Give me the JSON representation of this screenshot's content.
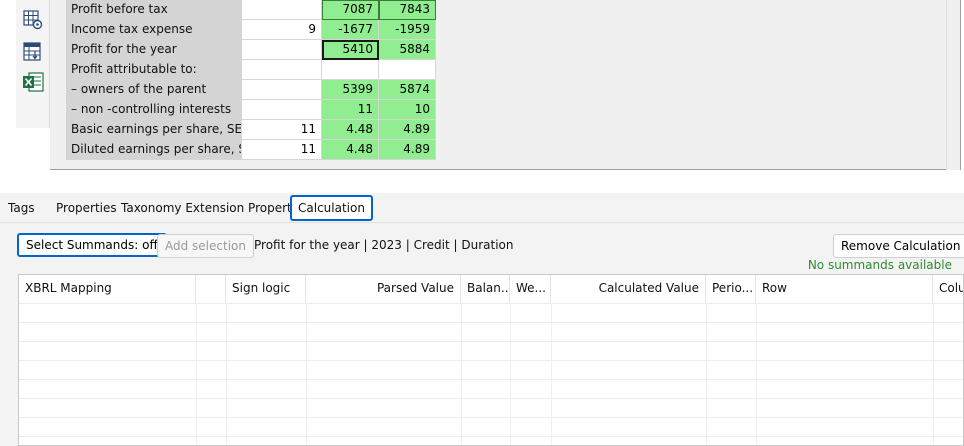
{
  "toolbar": {
    "icons": [
      "table-settings-icon",
      "table-sort-icon",
      "excel-icon"
    ]
  },
  "grid": {
    "rows": [
      {
        "label": "Profit before tax",
        "note": "",
        "v1": "7087",
        "v2": "7843"
      },
      {
        "label": "Income tax expense",
        "note": "9",
        "v1": "-1677",
        "v2": "-1959"
      },
      {
        "label": "Profit for the year",
        "note": "",
        "v1": "5410",
        "v2": "5884"
      },
      {
        "label": "Profit attributable to:",
        "note": "",
        "v1": "",
        "v2": ""
      },
      {
        "label": "– owners of the parent",
        "note": "",
        "v1": "5399",
        "v2": "5874"
      },
      {
        "label": "– non -controlling interests",
        "note": "",
        "v1": "11",
        "v2": "10"
      },
      {
        "label": "Basic earnings per share, SEK",
        "note": "11",
        "v1": "4.48",
        "v2": "4.89"
      },
      {
        "label": "Diluted earnings per share, S...",
        "note": "11",
        "v1": "4.48",
        "v2": "4.89"
      }
    ]
  },
  "tabs": [
    {
      "label": "Tags"
    },
    {
      "label": "Properties"
    },
    {
      "label": "Taxonomy Extension Properties"
    },
    {
      "label": "Calculation"
    }
  ],
  "calculation": {
    "select_summands_label": "Select Summands: off",
    "add_selection_label": "Add selection",
    "info": "Profit for the year | 2023 | Credit | Duration",
    "remove_label": "Remove Calculation",
    "status": "No summands available",
    "columns": [
      "XBRL Mapping",
      "",
      "Sign logic",
      "Parsed Value",
      "Balan...",
      "We...",
      "Calculated Value",
      "Perio...",
      "Row",
      "Colu"
    ]
  },
  "colors": {
    "green_cell": "#90ee90",
    "accent": "#0066cc",
    "status_green": "#2e8b2e"
  }
}
